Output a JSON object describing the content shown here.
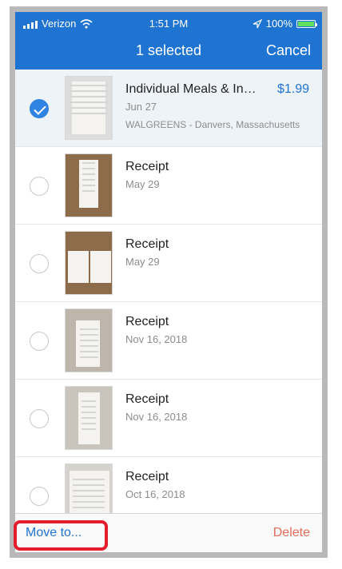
{
  "status_bar": {
    "carrier": "Verizon",
    "time": "1:51 PM",
    "battery": "100%"
  },
  "header": {
    "title": "1 selected",
    "cancel_label": "Cancel"
  },
  "receipts": [
    {
      "title": "Individual Meals & Inci...",
      "amount": "$1.99",
      "date": "Jun 27",
      "merchant": "WALGREENS - Danvers, Massachusetts",
      "selected": true
    },
    {
      "title": "Receipt",
      "date": "May 29",
      "selected": false
    },
    {
      "title": "Receipt",
      "date": "May 29",
      "selected": false
    },
    {
      "title": "Receipt",
      "date": "Nov 16, 2018",
      "selected": false
    },
    {
      "title": "Receipt",
      "date": "Nov 16, 2018",
      "selected": false
    },
    {
      "title": "Receipt",
      "date": "Oct 16, 2018",
      "selected": false
    }
  ],
  "bottom_bar": {
    "move_label": "Move to...",
    "delete_label": "Delete"
  },
  "colors": {
    "header": "#1f73d1",
    "accent": "#1f73d1",
    "delete": "#e36c5a",
    "highlight": "#e51c2c"
  },
  "icons": {
    "signal": "signal-bars-icon",
    "wifi": "wifi-icon",
    "location": "location-arrow-icon",
    "battery": "battery-icon",
    "checkmark": "checkmark-icon"
  }
}
